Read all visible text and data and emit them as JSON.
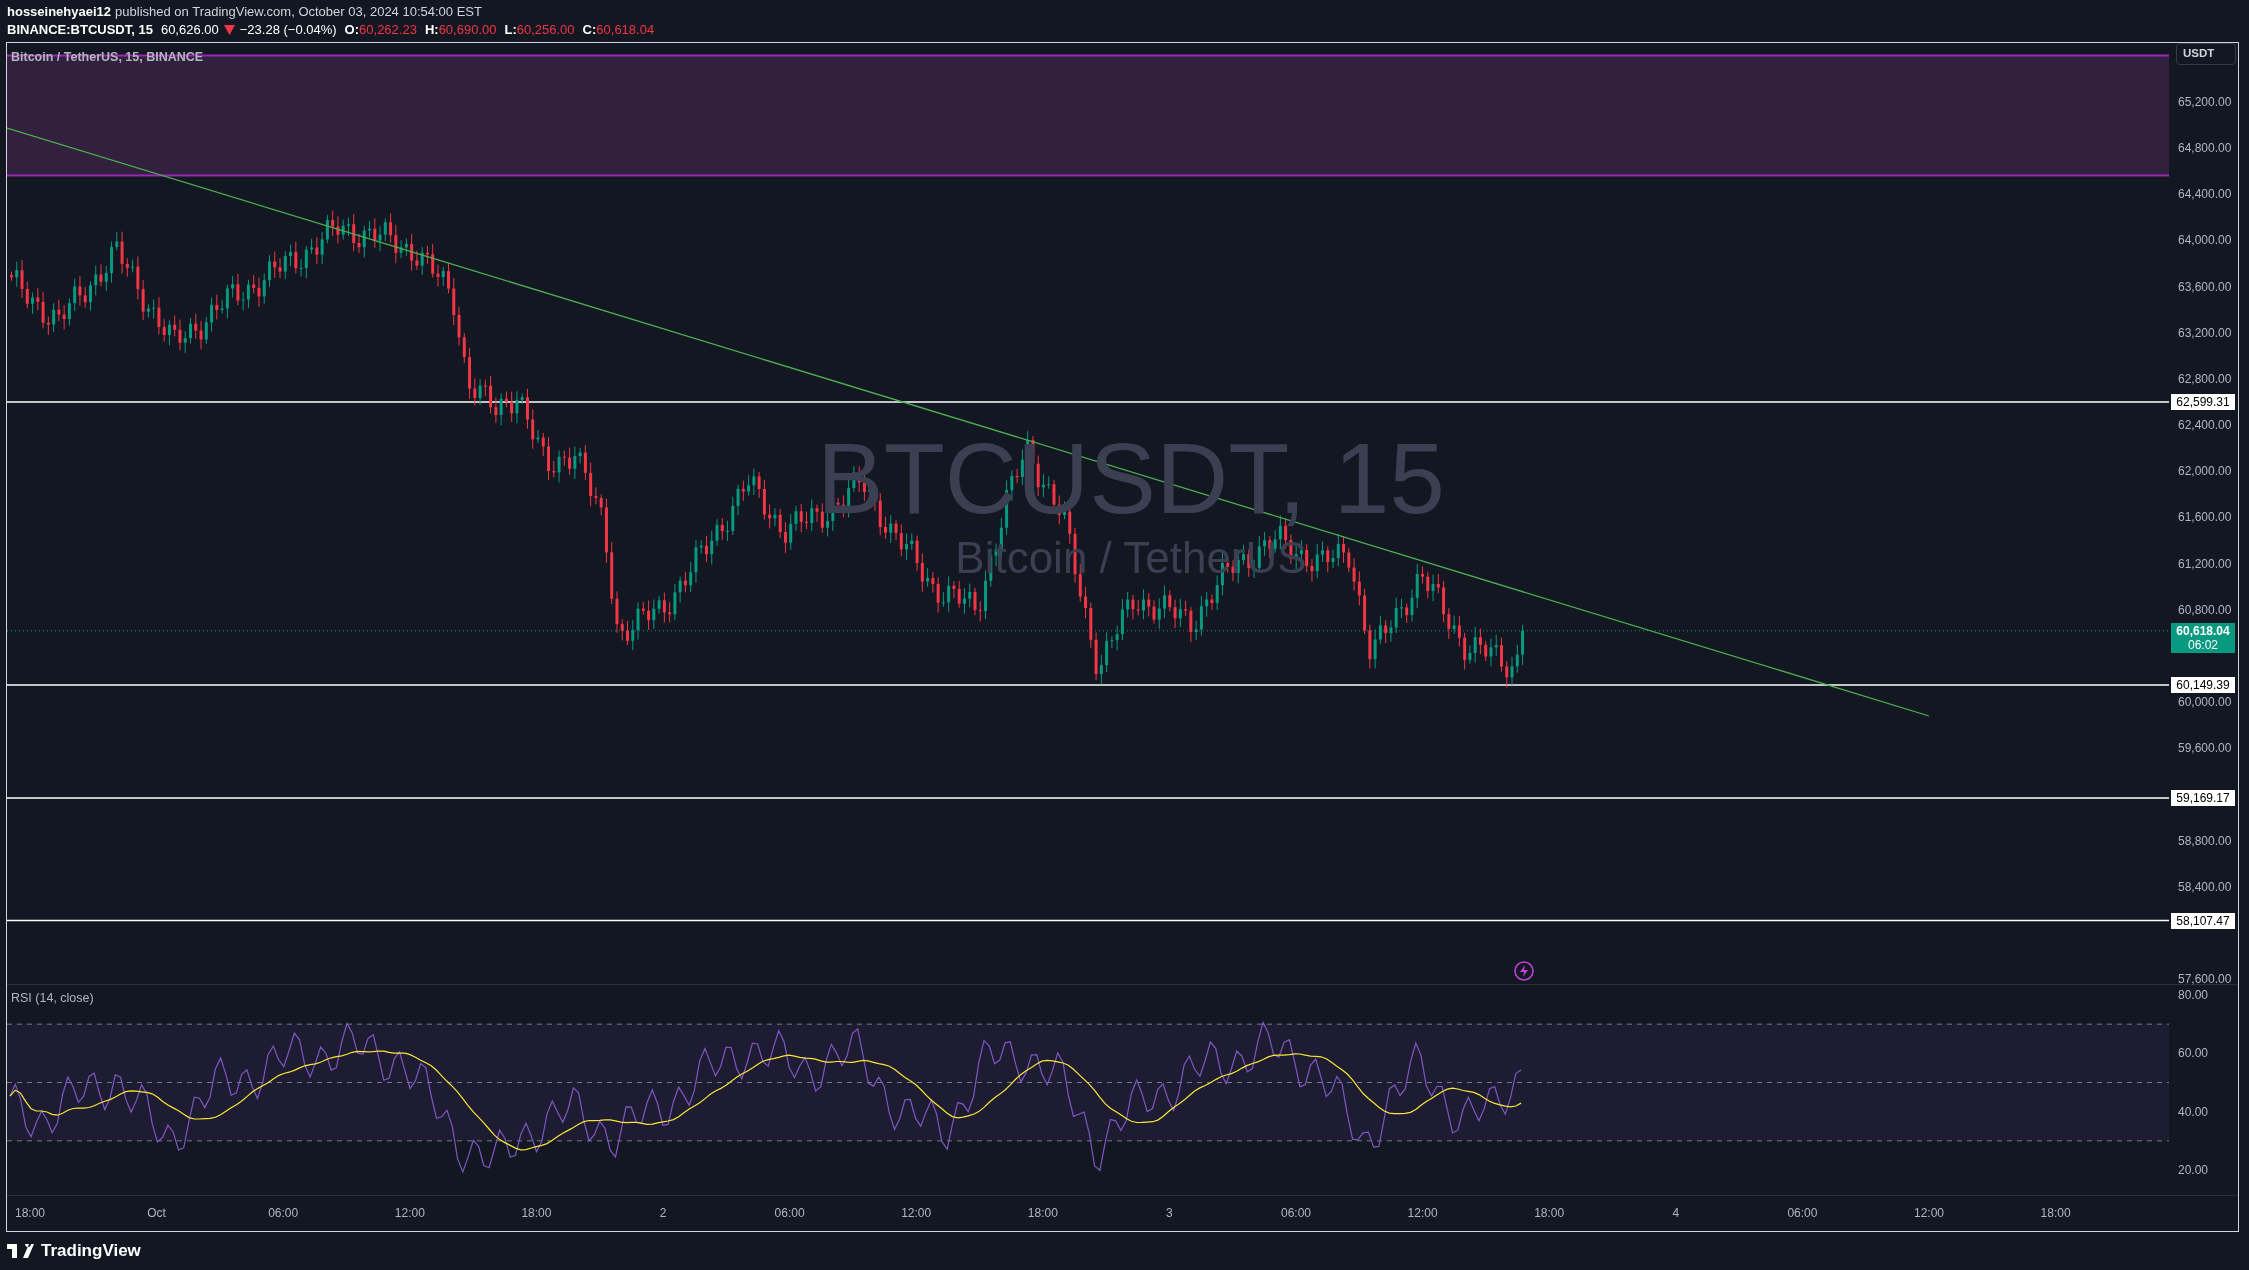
{
  "header": {
    "author": "hosseinehyaei12",
    "published": "published on TradingView.com, October 03, 2024 10:54:00 EST",
    "symbol": "BINANCE:BTCUSDT, 15",
    "last": "60,626.00",
    "falling": true,
    "change": "−23.28 (−0.04%)",
    "ohlc": [
      {
        "label": "O:",
        "value": "60,262.23"
      },
      {
        "label": "H:",
        "value": "60,690.00"
      },
      {
        "label": "L:",
        "value": "60,256.00"
      },
      {
        "label": "C:",
        "value": "60,618.04"
      }
    ]
  },
  "chart": {
    "legend": "Bitcoin / TetherUS, 15, BINANCE",
    "watermark": {
      "symbol": "BTCUSDT, 15",
      "description": "Bitcoin / TetherUS"
    },
    "currency": "USDT",
    "price_ticks": [
      "65,200.00",
      "64,800.00",
      "64,400.00",
      "64,000.00",
      "63,600.00",
      "63,200.00",
      "62,800.00",
      "62,400.00",
      "62,000.00",
      "61,600.00",
      "61,200.00",
      "60,800.00",
      "60,000.00",
      "59,600.00",
      "58,800.00",
      "58,400.00",
      "57,600.00"
    ],
    "levels": [
      {
        "label": "62,599.31"
      },
      {
        "label": "60,149.39"
      },
      {
        "label": "59,169.17"
      },
      {
        "label": "58,107.47"
      }
    ],
    "current_price": {
      "price": "60,618.04",
      "countdown": "06:02"
    }
  },
  "rsi": {
    "legend": "RSI (14, close)",
    "ticks": [
      "80.00",
      "60.00",
      "40.00",
      "20.00"
    ]
  },
  "time_axis": [
    "18:00",
    "Oct",
    "06:00",
    "12:00",
    "18:00",
    "2",
    "06:00",
    "12:00",
    "18:00",
    "3",
    "06:00",
    "12:00",
    "18:00",
    "4",
    "06:00",
    "12:00",
    "18:00"
  ],
  "footer": {
    "brand": "TradingView"
  }
}
